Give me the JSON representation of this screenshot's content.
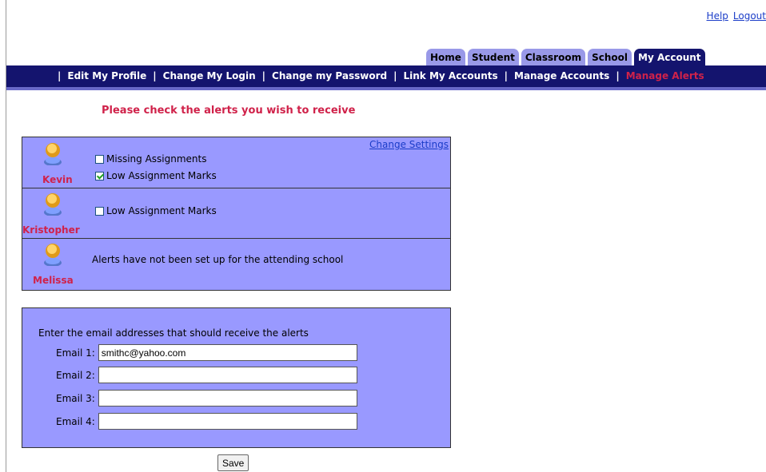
{
  "header": {
    "help_label": "Help",
    "logout_label": "Logout"
  },
  "tabs": [
    {
      "label": "Home"
    },
    {
      "label": "Student"
    },
    {
      "label": "Classroom"
    },
    {
      "label": "School"
    },
    {
      "label": "My Account",
      "active": true
    }
  ],
  "subnav": [
    {
      "label": "Edit My Profile"
    },
    {
      "label": "Change My Login"
    },
    {
      "label": "Change my Password"
    },
    {
      "label": "Link My Accounts"
    },
    {
      "label": "Manage Accounts"
    },
    {
      "label": "Manage Alerts",
      "current": true
    }
  ],
  "main": {
    "heading": "Please check the alerts you wish to receive",
    "change_settings_label": "Change Settings",
    "children": [
      {
        "name": "Kevin",
        "alerts": [
          {
            "label": "Missing Assignments",
            "checked": false
          },
          {
            "label": "Low Assignment Marks",
            "checked": true
          }
        ]
      },
      {
        "name": "Kristopher",
        "alerts": [
          {
            "label": "Low Assignment Marks",
            "checked": false
          }
        ]
      },
      {
        "name": "Melissa",
        "message": "Alerts have not been set up for the attending school"
      }
    ]
  },
  "email": {
    "prompt": "Enter the email addresses that should receive the alerts",
    "fields": [
      {
        "label": "Email 1:",
        "value": "smithc@yahoo.com"
      },
      {
        "label": "Email 2:",
        "value": ""
      },
      {
        "label": "Email 3:",
        "value": ""
      },
      {
        "label": "Email 4:",
        "value": ""
      }
    ]
  },
  "save_label": "Save",
  "colors": {
    "nav_bg": "#14146e",
    "tab_bg": "#9999e8",
    "panel_bg": "#9999ff",
    "accent_red": "#d0224a",
    "link_blue": "#1a3cc8"
  },
  "icons": {
    "avatar": "person-avatar-icon"
  }
}
